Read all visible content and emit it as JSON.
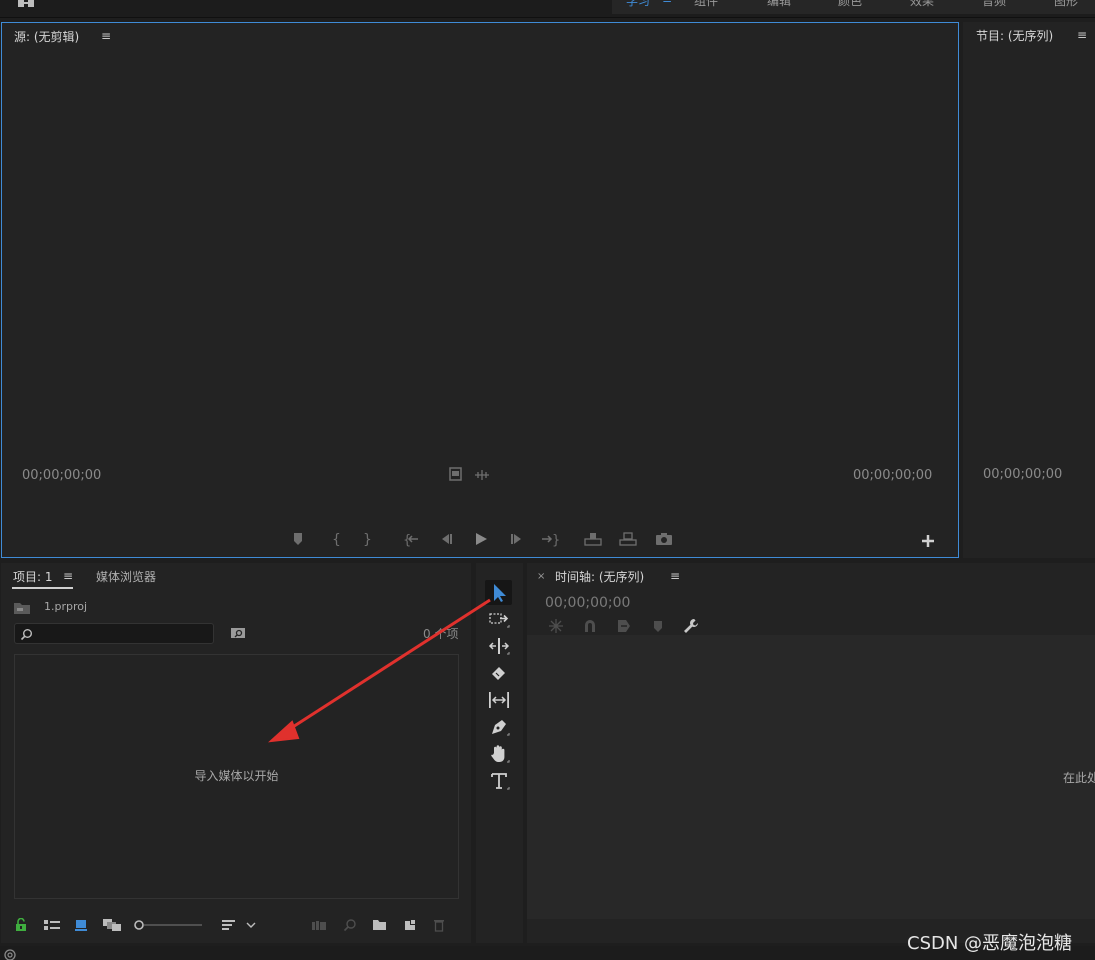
{
  "workspaces": {
    "tabs": [
      "学习",
      "组件",
      "编辑",
      "颜色",
      "效果",
      "音频",
      "图形"
    ],
    "active_index": 0
  },
  "source_monitor": {
    "title": "源: (无剪辑)",
    "timecode_left": "00;00;00;00",
    "timecode_right": "00;00;00;00"
  },
  "program_monitor": {
    "title": "节目: (无序列)",
    "timecode": "00;00;00;00"
  },
  "project_panel": {
    "tab_project": "项目: 1",
    "tab_media_browser": "媒体浏览器",
    "filename": "1.prproj",
    "item_count": "0 个项",
    "empty_message": "导入媒体以开始"
  },
  "timeline": {
    "close_glyph": "×",
    "title": "时间轴: (无序列)",
    "timecode": "00;00;00;00",
    "drop_hint": "在此处"
  },
  "watermark": "CSDN @恶魔泡泡糖",
  "colors": {
    "accent_blue": "#3f8bd6",
    "annotation_red": "#e0312d",
    "lock_green": "#3fae3f"
  },
  "icons": {
    "source_controls": [
      "add-marker-icon",
      "mark-in-icon",
      "mark-out-icon",
      "go-to-in-icon",
      "step-back-icon",
      "play-icon",
      "step-forward-icon",
      "go-to-out-icon",
      "insert-icon",
      "overwrite-icon",
      "export-frame-icon"
    ],
    "tools": [
      "selection-tool-icon",
      "track-select-tool-icon",
      "ripple-edit-tool-icon",
      "razor-tool-icon",
      "slip-tool-icon",
      "pen-tool-icon",
      "hand-tool-icon",
      "type-tool-icon"
    ]
  }
}
